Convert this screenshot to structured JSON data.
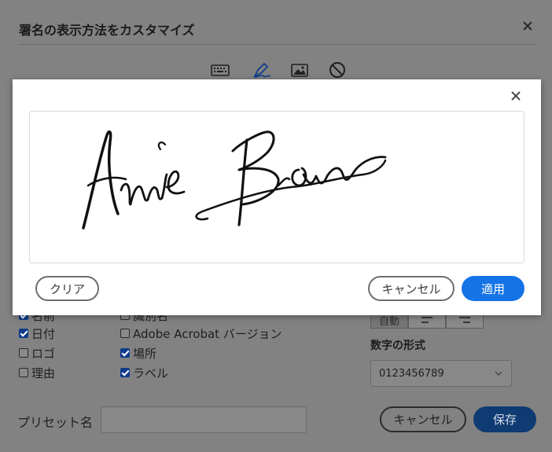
{
  "backdrop": {
    "title": "署名の表示方法をカスタマイズ",
    "modes": [
      "keyboard-icon",
      "pen-icon",
      "image-icon",
      "none-icon"
    ],
    "checkboxes": {
      "name": {
        "label": "名前",
        "checked": true
      },
      "date": {
        "label": "日付",
        "checked": true
      },
      "logo": {
        "label": "ロゴ",
        "checked": false
      },
      "reason": {
        "label": "理由",
        "checked": false
      },
      "distinguished": {
        "label": "識別名",
        "checked": false
      },
      "version": {
        "label": "Adobe Acrobat バージョン",
        "checked": false
      },
      "location": {
        "label": "場所",
        "checked": true
      },
      "labels": {
        "label": "ラベル",
        "checked": true
      }
    },
    "text_direction": {
      "auto_label": "自動",
      "options": [
        "align-left-icon",
        "align-right-icon"
      ]
    },
    "number_format": {
      "label": "数字の形式",
      "value": "0123456789"
    },
    "preset": {
      "label": "プリセット名",
      "value": ""
    },
    "cancel_label": "キャンセル",
    "save_label": "保存"
  },
  "draw_modal": {
    "signature_text": "Annie Brown",
    "clear_label": "クリア",
    "cancel_label": "キャンセル",
    "apply_label": "適用",
    "accent": "#1473e6"
  }
}
